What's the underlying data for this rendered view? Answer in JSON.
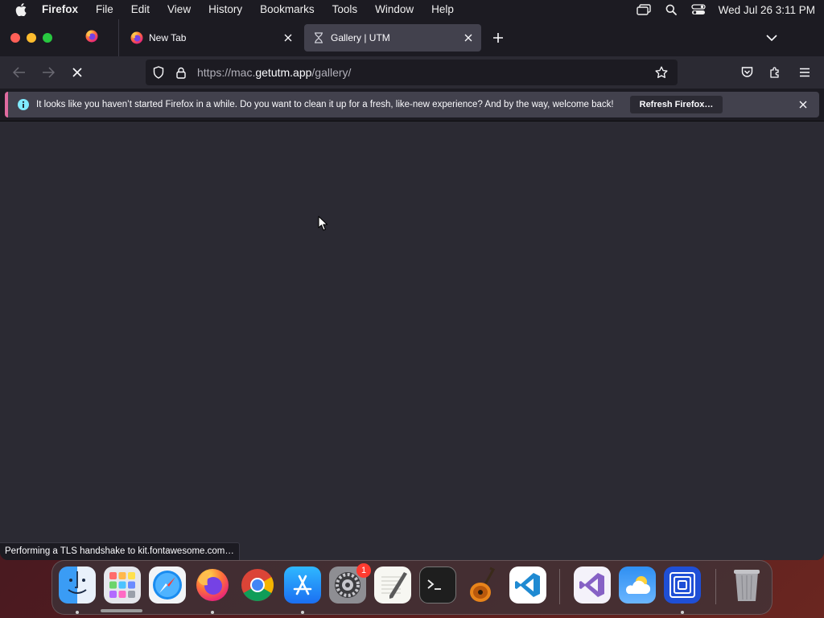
{
  "menubar": {
    "app_name": "Firefox",
    "items": [
      "File",
      "Edit",
      "View",
      "History",
      "Bookmarks",
      "Tools",
      "Window",
      "Help"
    ],
    "clock": "Wed Jul 26  3:11 PM",
    "status_icons": [
      "display-icon",
      "spotlight-search-icon",
      "control-center-icon"
    ]
  },
  "tabs": [
    {
      "title": "New Tab",
      "favicon": "firefox-icon",
      "active": false
    },
    {
      "title": "Gallery | UTM",
      "favicon": "hourglass-icon",
      "active": true
    }
  ],
  "urlbar": {
    "url_prefix": "https://mac.",
    "url_host": "getutm.app",
    "url_path": "/gallery/"
  },
  "notification": {
    "message": "It looks like you haven’t started Firefox in a while. Do you want to clean it up for a fresh, like-new experience? And by the way, welcome back!",
    "button": "Refresh Firefox…"
  },
  "status_panel": "Performing a TLS handshake to kit.fontawesome.com…",
  "dock": {
    "apps": [
      "Finder",
      "Launchpad",
      "Safari",
      "Firefox",
      "Google Chrome",
      "App Store",
      "System Settings",
      "TextEdit",
      "Terminal",
      "GarageBand",
      "Visual Studio Code",
      "Visual Studio",
      "Weather",
      "UTM",
      "Trash"
    ],
    "settings_badge": "1"
  },
  "colors": {
    "accent_notification": "#e06ba0",
    "toolbar": "#2b2a33",
    "tab_active": "#42414d"
  }
}
